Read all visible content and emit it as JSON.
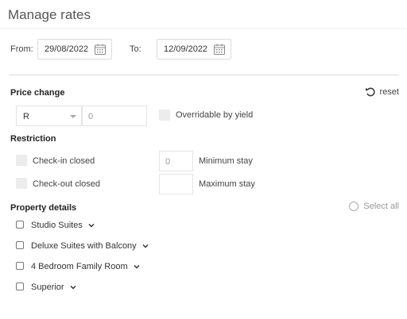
{
  "header": {
    "title": "Manage rates"
  },
  "dates": {
    "from_label": "From:",
    "from_value": "29/08/2022",
    "to_label": "To:",
    "to_value": "12/09/2022"
  },
  "price_change": {
    "heading": "Price change",
    "reset_label": "reset",
    "select_value": "R",
    "amount_value": "0",
    "overridable_label": "Overridable by yield"
  },
  "restriction": {
    "heading": "Restriction",
    "checkin_label": "Check-in closed",
    "checkout_label": "Check-out closed",
    "min_stay_value": "0",
    "min_stay_label": "Minimum stay",
    "max_stay_value": "",
    "max_stay_label": "Maximum stay"
  },
  "property": {
    "heading": "Property details",
    "select_all_label": "Select all",
    "items": [
      {
        "label": "Studio Suites"
      },
      {
        "label": "Deluxe Suites with Balcony"
      },
      {
        "label": "4 Bedroom Family Room"
      },
      {
        "label": "Superior"
      }
    ]
  },
  "icons": {
    "calendar": "calendar-icon",
    "reset": "undo-icon",
    "chevron": "chevron-down-icon"
  }
}
